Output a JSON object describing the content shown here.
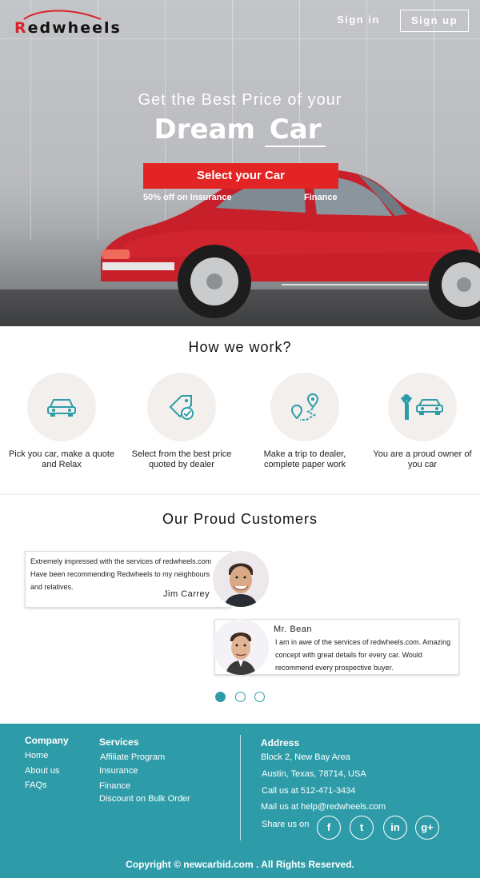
{
  "header": {
    "logo_text": "Redwheels",
    "nav": {
      "signin": "Sign in",
      "signup": "Sign up"
    }
  },
  "hero": {
    "subtitle": "Get the Best Price of your",
    "title_part1": "Dream",
    "title_part2": "Car",
    "cta": "Select your Car",
    "links": [
      "50% off on Insurance",
      "Finance"
    ]
  },
  "how": {
    "title": "How we work?",
    "steps": [
      {
        "icon": "car-icon",
        "text": "Pick you car, make a quote and Relax"
      },
      {
        "icon": "price-tag-icon",
        "text": "Select from the best price quoted by dealer"
      },
      {
        "icon": "route-pin-icon",
        "text": "Make a trip to dealer, complete paper work"
      },
      {
        "icon": "owner-car-icon",
        "text": "You are a proud owner of you car"
      }
    ]
  },
  "customers": {
    "title": "Our Proud Customers",
    "testimonials": [
      {
        "quote": "Extremely impressed with the services of redwheels.com Have been recommending Redwheels to my neighbours and relatives.",
        "name": "Jim Carrey"
      },
      {
        "quote": "I am in awe of the services of redwheels.com. Amazing concept with great details for every car. Would recommend every prospective buyer.",
        "name": "Mr. Bean"
      }
    ],
    "carousel_active_index": 0,
    "carousel_count": 3
  },
  "footer": {
    "company": {
      "heading": "Company",
      "links": [
        "Home",
        "About us",
        "FAQs"
      ]
    },
    "services": {
      "heading": "Services",
      "links": [
        "Affiliate Program",
        "Insurance",
        "Finance",
        "Discount on Bulk Order"
      ]
    },
    "address": {
      "heading": "Address",
      "lines": [
        "Block 2, New Bay Area",
        "Austin, Texas, 78714, USA",
        "Call us at 512-471-3434",
        "Mail us at help@redwheels.com"
      ],
      "share_label": "Share us on",
      "social": [
        "f",
        "t",
        "in",
        "g+"
      ]
    },
    "copyright": "Copyright ©  newcarbid.com . All Rights Reserved."
  },
  "colors": {
    "accent_red": "#e32424",
    "teal": "#2e9ca8"
  }
}
